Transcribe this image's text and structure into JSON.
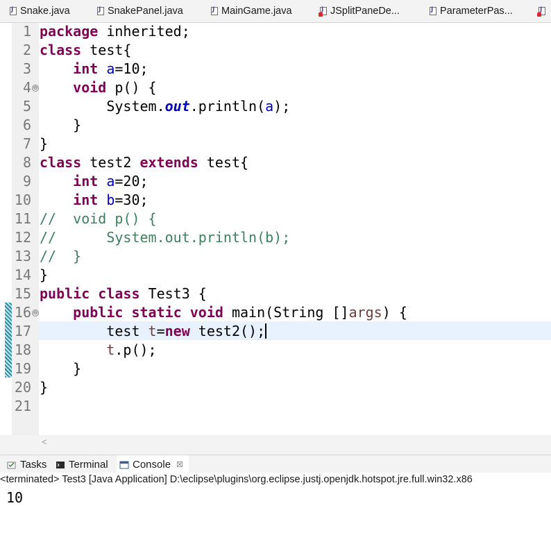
{
  "editor_tabs": [
    {
      "label": "Snake.java",
      "has_error": false
    },
    {
      "label": "SnakePanel.java",
      "has_error": false
    },
    {
      "label": "MainGame.java",
      "has_error": false
    },
    {
      "label": "JSplitPaneDe...",
      "has_error": true
    },
    {
      "label": "ParameterPas...",
      "has_error": false
    }
  ],
  "line_numbers": [
    "1",
    "2",
    "3",
    "4",
    "5",
    "6",
    "7",
    "8",
    "9",
    "10",
    "11",
    "12",
    "13",
    "14",
    "15",
    "16",
    "17",
    "18",
    "19",
    "20",
    "21"
  ],
  "code": {
    "l1_kw": "package",
    "l1_rest": " inherited;",
    "l2_kw": "class",
    "l2_rest": " test{",
    "l3_indent": "    ",
    "l3_kw": "int",
    "l3_sp": " ",
    "l3_fld": "a",
    "l3_rest": "=10;",
    "l4_indent": "    ",
    "l4_kw": "void",
    "l4_rest": " p() {",
    "l5_indent": "        ",
    "l5_a": "System.",
    "l5_sfld": "out",
    "l5_b": ".println(",
    "l5_fld": "a",
    "l5_c": ");",
    "l6": "    }",
    "l7": "}",
    "l8_kw": "class",
    "l8_a": " test2 ",
    "l8_kw2": "extends",
    "l8_b": " test{",
    "l9_indent": "    ",
    "l9_kw": "int",
    "l9_sp": " ",
    "l9_fld": "b_a",
    "l9_fld_text": "a",
    "l9_rest": "=20;",
    "l10_indent": "    ",
    "l10_kw": "int",
    "l10_sp": " ",
    "l10_fld": "b",
    "l10_rest": "=30;",
    "l11": "//  void p() {",
    "l12": "//      System.out.println(b);",
    "l13": "//  }",
    "l14": "}",
    "l15_kw": "public",
    "l15_sp": " ",
    "l15_kw2": "class",
    "l15_rest": " Test3 {",
    "l16_indent": "    ",
    "l16_kw": "public",
    "l16_sp1": " ",
    "l16_kw2": "static",
    "l16_sp2": " ",
    "l16_kw3": "void",
    "l16_a": " main(String []",
    "l16_lv": "args",
    "l16_b": ") {",
    "l17_indent": "        ",
    "l17_a": "test ",
    "l17_lv": "t",
    "l17_b": "=",
    "l17_kw": "new",
    "l17_c": " test2();",
    "l18_indent": "        ",
    "l18_lv": "t",
    "l18_rest": ".p();",
    "l19": "    }",
    "l20": "}"
  },
  "panel": {
    "tabs": [
      "Tasks",
      "Terminal",
      "Console"
    ],
    "close_glyph": "☒",
    "status": "<terminated> Test3 [Java Application] D:\\eclipse\\plugins\\org.eclipse.justj.openjdk.hotspot.jre.full.win32.x86",
    "output": "10"
  },
  "scroll_left_glyph": "<",
  "fold_glyph": "⊖",
  "colors": {
    "keyword": "#7f0055",
    "field": "#0000c0",
    "comment": "#3f7f5f",
    "current_line": "#e8f2fe"
  }
}
